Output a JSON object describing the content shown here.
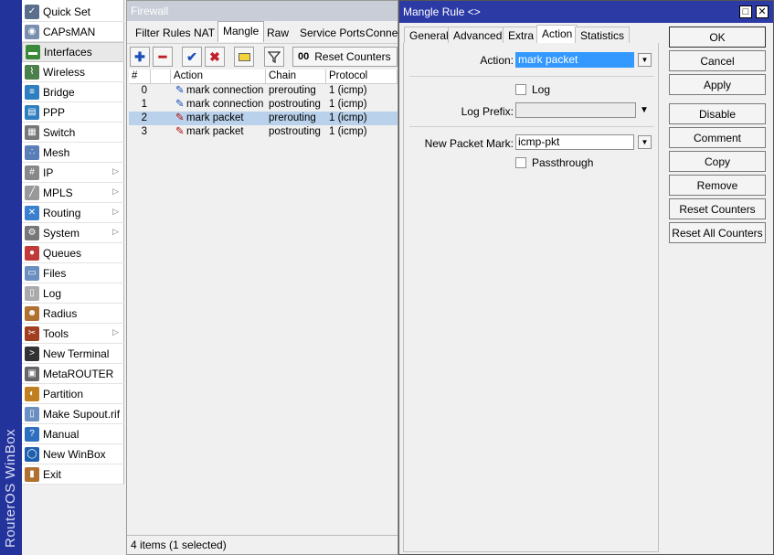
{
  "brand": {
    "text": "RouterOS WinBox",
    "strip_color": "#23339c"
  },
  "sidebar": {
    "items": [
      {
        "label": "Quick Set",
        "icon": "quick-set-icon",
        "submenu": false
      },
      {
        "label": "CAPsMAN",
        "icon": "capsman-icon",
        "submenu": false
      },
      {
        "label": "Interfaces",
        "icon": "interfaces-icon",
        "submenu": false
      },
      {
        "label": "Wireless",
        "icon": "wireless-icon",
        "submenu": false
      },
      {
        "label": "Bridge",
        "icon": "bridge-icon",
        "submenu": false
      },
      {
        "label": "PPP",
        "icon": "ppp-icon",
        "submenu": false
      },
      {
        "label": "Switch",
        "icon": "switch-icon",
        "submenu": false
      },
      {
        "label": "Mesh",
        "icon": "mesh-icon",
        "submenu": false
      },
      {
        "label": "IP",
        "icon": "ip-icon",
        "submenu": true
      },
      {
        "label": "MPLS",
        "icon": "mpls-icon",
        "submenu": true
      },
      {
        "label": "Routing",
        "icon": "routing-icon",
        "submenu": true
      },
      {
        "label": "System",
        "icon": "system-icon",
        "submenu": true
      },
      {
        "label": "Queues",
        "icon": "queues-icon",
        "submenu": false
      },
      {
        "label": "Files",
        "icon": "files-icon",
        "submenu": false
      },
      {
        "label": "Log",
        "icon": "log-icon",
        "submenu": false
      },
      {
        "label": "Radius",
        "icon": "radius-icon",
        "submenu": false
      },
      {
        "label": "Tools",
        "icon": "tools-icon",
        "submenu": true
      },
      {
        "label": "New Terminal",
        "icon": "terminal-icon",
        "submenu": false
      },
      {
        "label": "MetaROUTER",
        "icon": "metarouter-icon",
        "submenu": false
      },
      {
        "label": "Partition",
        "icon": "partition-icon",
        "submenu": false
      },
      {
        "label": "Make Supout.rif",
        "icon": "supout-icon",
        "submenu": false
      },
      {
        "label": "Manual",
        "icon": "manual-icon",
        "submenu": false
      },
      {
        "label": "New WinBox",
        "icon": "winbox-icon",
        "submenu": false
      },
      {
        "label": "Exit",
        "icon": "exit-icon",
        "submenu": false
      }
    ]
  },
  "firewall": {
    "title": "Firewall",
    "tabs": [
      "Filter Rules",
      "NAT",
      "Mangle",
      "Raw",
      "Service Ports",
      "Connec"
    ],
    "active_tab": "Mangle",
    "toolbar": {
      "reset_counters": "Reset Counters",
      "reset_icon_text": "00"
    },
    "columns": [
      "#",
      "",
      "Action",
      "Chain",
      "Protocol"
    ],
    "rows": [
      {
        "num": "0",
        "action": "mark connection",
        "chain": "prerouting",
        "protocol": "1 (icmp)",
        "selected": false
      },
      {
        "num": "1",
        "action": "mark connection",
        "chain": "postrouting",
        "protocol": "1 (icmp)",
        "selected": false
      },
      {
        "num": "2",
        "action": "mark packet",
        "chain": "prerouting",
        "protocol": "1 (icmp)",
        "selected": true
      },
      {
        "num": "3",
        "action": "mark packet",
        "chain": "postrouting",
        "protocol": "1 (icmp)",
        "selected": false
      }
    ],
    "status": "4 items (1 selected)"
  },
  "dialog": {
    "title": "Mangle Rule <>",
    "tabs": [
      "General",
      "Advanced",
      "Extra",
      "Action",
      "Statistics"
    ],
    "active_tab": "Action",
    "fields": {
      "action_label": "Action:",
      "action_value": "mark packet",
      "log_label": "Log",
      "log_prefix_label": "Log Prefix:",
      "log_prefix_value": "",
      "new_packet_mark_label": "New Packet Mark:",
      "new_packet_mark_value": "icmp-pkt",
      "passthrough_label": "Passthrough"
    },
    "buttons": [
      "OK",
      "Cancel",
      "Apply",
      "Disable",
      "Comment",
      "Copy",
      "Remove",
      "Reset Counters",
      "Reset All Counters"
    ],
    "colors": {
      "title_bar": "#2c3aa6",
      "selection": "#3399ff"
    }
  }
}
